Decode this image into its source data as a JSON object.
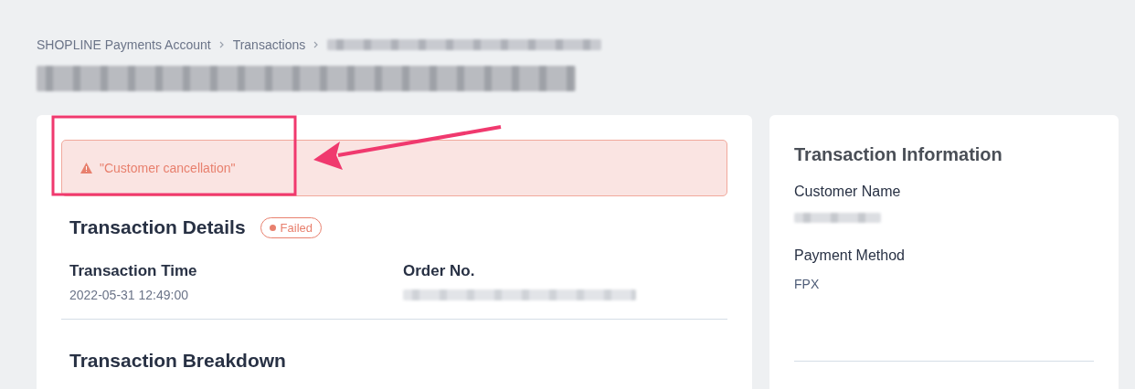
{
  "breadcrumb": [
    {
      "label": "SHOPLINE Payments Account"
    },
    {
      "label": "Transactions"
    }
  ],
  "alert": {
    "message": "\"Customer cancellation\""
  },
  "details": {
    "title": "Transaction Details",
    "status": {
      "label": "Failed",
      "color": "#e8806e"
    },
    "fields": [
      {
        "label": "Transaction Time",
        "value": "2022-05-31 12:49:00",
        "redacted": false
      },
      {
        "label": "Order No.",
        "redacted": true
      }
    ]
  },
  "breakdown": {
    "title": "Transaction Breakdown"
  },
  "info": {
    "title": "Transaction Information",
    "fields": [
      {
        "label": "Customer Name",
        "redacted": true
      },
      {
        "label": "Payment Method",
        "value": "FPX",
        "redacted": false
      }
    ]
  }
}
